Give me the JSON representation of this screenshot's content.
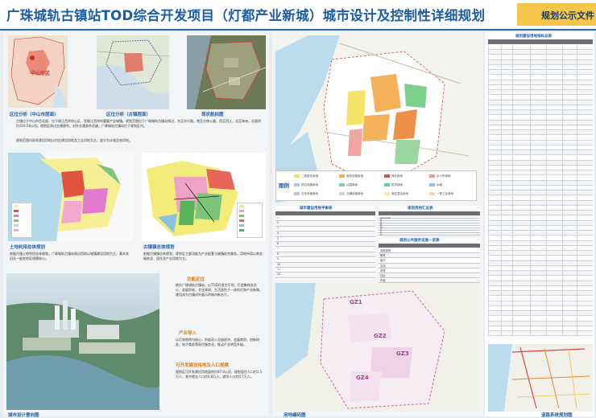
{
  "header": {
    "title": "广珠城轨古镇站TOD综合开发项目（灯都产业新城）城市设计及控制性详细规划",
    "badge": "规划公示文件"
  },
  "left": {
    "map1_caption": "区位分析（中山市层面）",
    "map1_label": "中山市区",
    "map2_caption": "区位分析（古镇层面）",
    "map3_caption": "现状航拍图",
    "paragraph1": "古镇位于中山市西北部，位于珠江西岸核心区，是珠江西岸的重要产业城镇。规划范围位于广珠城轨古镇站周边，东至东兴路，南至古神公路，西至西江，北至海洲，总面积约316.58公顷。规划区周边交通便利，对外交通条件优越，广珠城轨古镇站位于规划区内。",
    "paragraph2": "规划范围内现状建设用地以村庄建设用地及工业用地为主，部分为水域及农用地。",
    "landuse_caption": "土地利用总体规划",
    "landuse_text": "依据古镇土地利用总体规划，广珠城轨古镇站周边用地以城镇建设用地为主，基本农田及一般农地区规模较小。",
    "master_caption": "古镇镇总体规划",
    "master_text": "依据古镇镇总体规划，规划区主要功能为产业配套与城镇综合服务，用地布局以商业服务业、居住及产业用地为主。",
    "aerial_caption": "城市设计意向图",
    "pos_title": "功能定位",
    "pos_text": "依托广珠城轨古镇站，以TOD开发为引领，打造集商务办公、会展贸易、文化休闲、生活居住于一体的灯饰产业新城，建设成为古镇对外展示的城市新名片。",
    "ind_title": "产业导入",
    "ind_text": "以灯饰照明为核心，积极导入总部经济、会展商贸、创新研发、电子商务等现代服务业，推动产业转型升级。",
    "pop_title": "可开发建设用地及人口规模",
    "pop_text": "规划区可开发建设用地面积约97.0公顷，规划居住人口约1.5万人，其中就业人口约0.8万人，就学人口约0.7万人。"
  },
  "middle": {
    "legend_title": "图例",
    "legend": [
      {
        "color": "#f4e04d",
        "label": "二类居住用地"
      },
      {
        "color": "#f5b041",
        "label": "商务设施用地"
      },
      {
        "color": "#e74c3c",
        "label": "商业用地"
      },
      {
        "color": "#f1948a",
        "label": "中小学用地"
      },
      {
        "color": "#a9cce3",
        "label": "供应设施用地"
      },
      {
        "color": "#7dcea0",
        "label": "公园绿地"
      },
      {
        "color": "#58d68d",
        "label": "防护绿地"
      },
      {
        "color": "#85c1e9",
        "label": "水域"
      },
      {
        "color": "#d2b4de",
        "label": "文化设施用地"
      },
      {
        "color": "#ccd1d1",
        "label": "交通设施用地"
      },
      {
        "color": "#f9e79f",
        "label": "商住混合用地"
      },
      {
        "color": "#fad7a0",
        "label": "一类工业用地"
      }
    ],
    "table1_title": "城市建设用地平衡表",
    "table2_title": "规划用地汇总表",
    "table3_title": "规划公共服务设施一览表",
    "table1_rows": [
      "1",
      "2",
      "3",
      "4",
      "5",
      "6",
      "7",
      "8",
      "9",
      "10",
      "11",
      "12"
    ],
    "table2_rows": [
      "用地代码",
      "R",
      "A",
      "B",
      "M",
      "S",
      "U",
      "G"
    ],
    "table3_rows": [
      "设施类别",
      "教育",
      "医疗",
      "文化",
      "体育",
      "社区",
      "市政"
    ],
    "zones": [
      "GZ1",
      "GZ2",
      "GZ3",
      "GZ4"
    ],
    "bottom_caption": "用地编码图"
  },
  "right": {
    "table_title": "规划建设用地指标总表",
    "road_caption": "道路系统规划图",
    "rows": 58
  }
}
